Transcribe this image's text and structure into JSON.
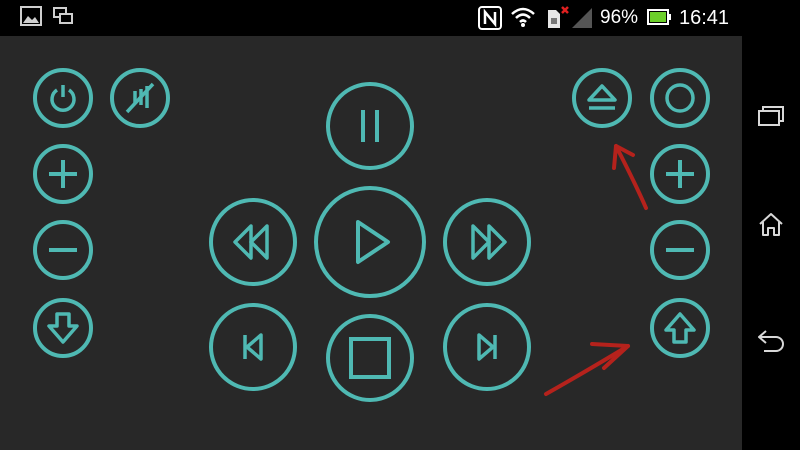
{
  "status_bar": {
    "battery": "96%",
    "time": "16:41",
    "icons": [
      "gallery-icon",
      "screen-mirror-icon",
      "nfc-icon",
      "wifi-icon",
      "sim-icon",
      "signal-icon",
      "battery-icon"
    ]
  },
  "remote": {
    "accent_color": "#4fb9b3",
    "background_color": "#282828",
    "left_column": [
      "power-icon",
      "mute-icon",
      "volume-up-icon",
      "volume-down-icon",
      "channel-down-icon"
    ],
    "center": [
      "pause-icon",
      "rewind-icon",
      "play-icon",
      "fast-forward-icon",
      "skip-previous-icon",
      "stop-icon",
      "skip-next-icon"
    ],
    "right_column": [
      "eject-icon",
      "record-icon",
      "plus-icon",
      "minus-icon",
      "channel-up-icon"
    ]
  },
  "annotations": {
    "arrow_color": "#b5221c",
    "count": 2
  },
  "navigation_bar": [
    "recent-apps-icon",
    "home-icon",
    "back-icon"
  ]
}
